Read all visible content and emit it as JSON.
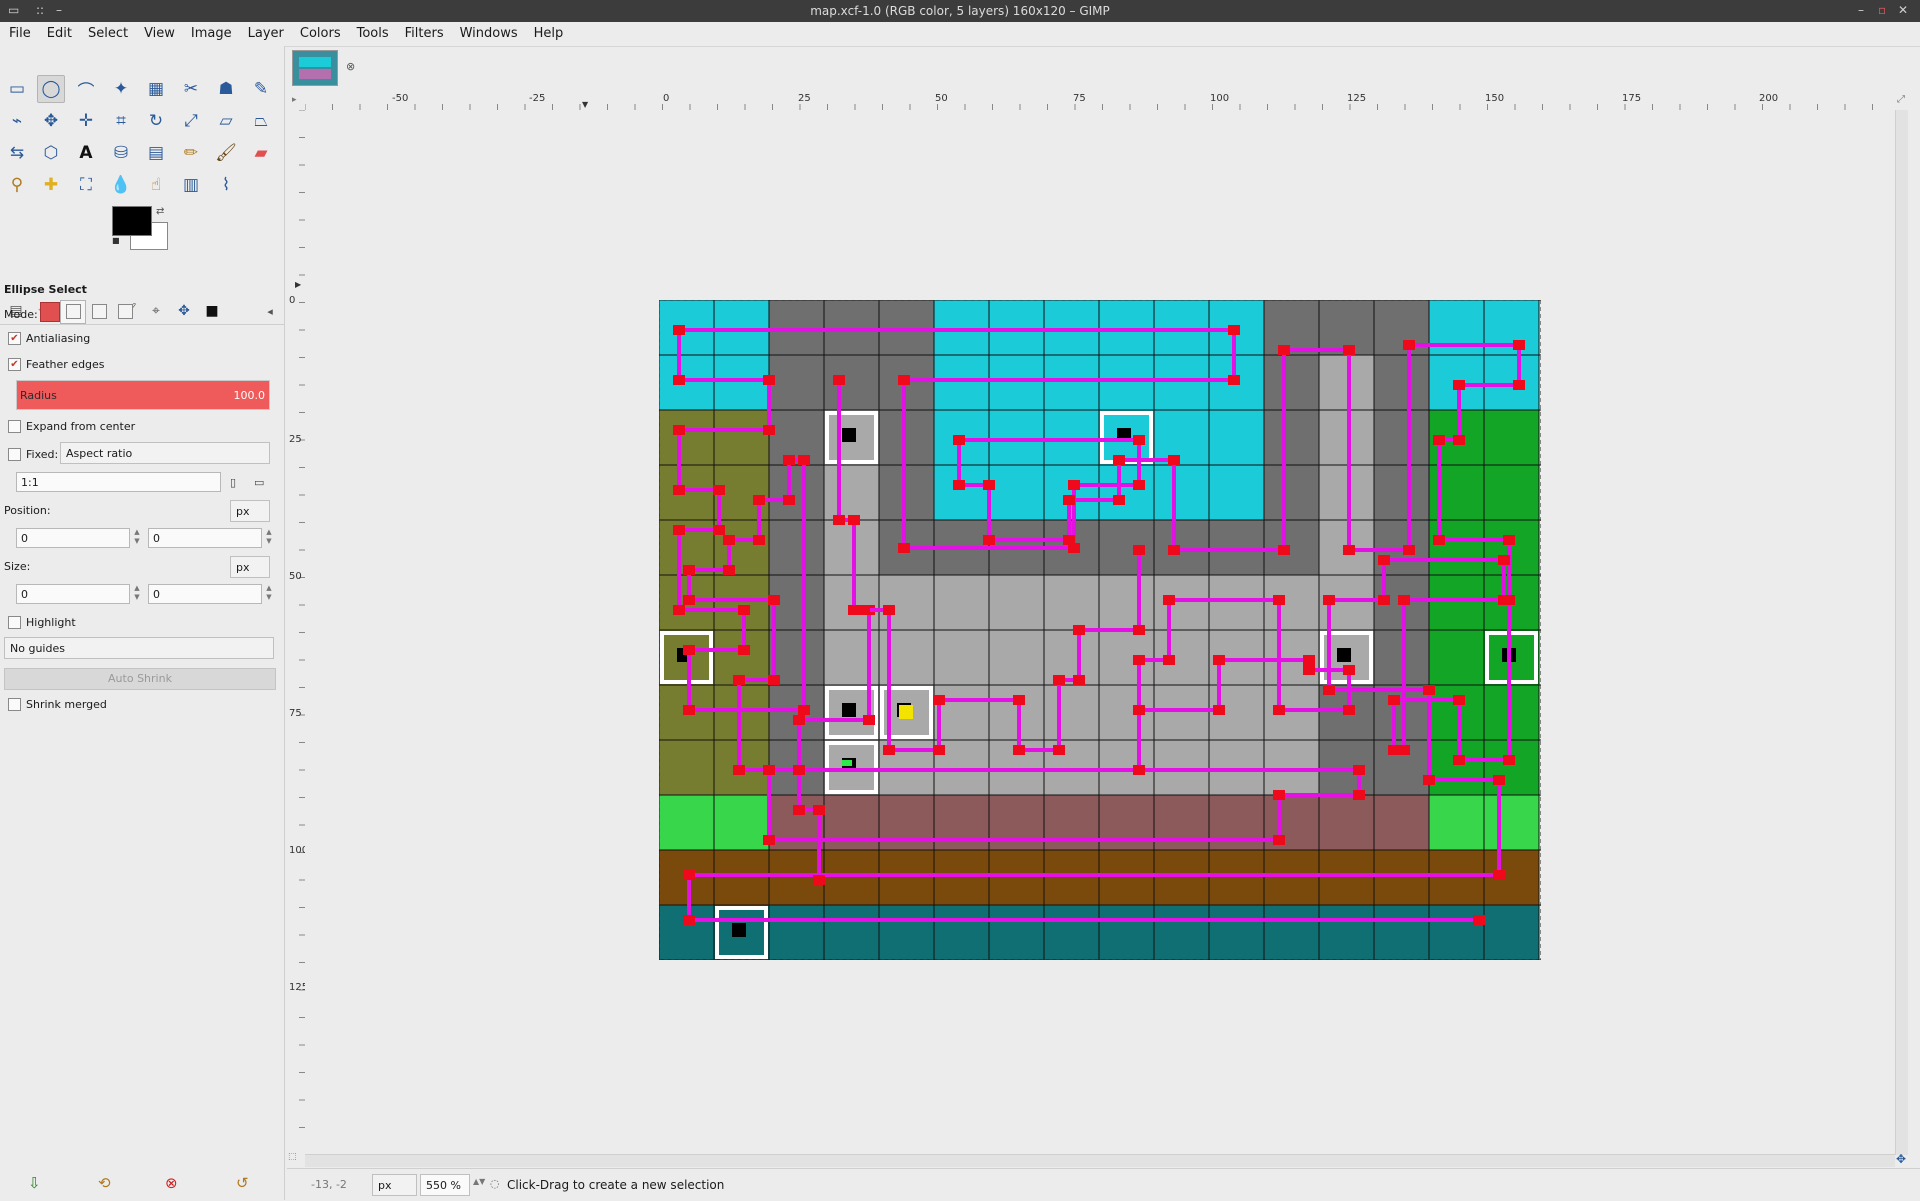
{
  "window": {
    "title": "map.xcf-1.0 (RGB color, 5 layers) 160x120 – GIMP"
  },
  "menu": [
    "File",
    "Edit",
    "Select",
    "View",
    "Image",
    "Layer",
    "Colors",
    "Tools",
    "Filters",
    "Windows",
    "Help"
  ],
  "tool_options": {
    "title": "Ellipse Select",
    "mode_label": "Mode:",
    "antialiasing": "Antialiasing",
    "feather": "Feather edges",
    "radius_label": "Radius",
    "radius_value": "100.0",
    "expand": "Expand from center",
    "fixed": "Fixed:",
    "fixed_mode": "Aspect ratio",
    "ratio": "1:1",
    "position_label": "Position:",
    "position_unit": "px",
    "position_x": "0",
    "position_y": "0",
    "size_label": "Size:",
    "size_unit": "px",
    "size_w": "0",
    "size_h": "0",
    "highlight": "Highlight",
    "guides": "No guides",
    "auto_shrink": "Auto Shrink",
    "shrink_merged": "Shrink merged"
  },
  "hruler_labels": [
    "-50",
    "-25",
    "0",
    "25",
    "50",
    "75",
    "100",
    "125",
    "150",
    "175",
    "200"
  ],
  "vruler_labels": [
    "0",
    "25",
    "50",
    "75",
    "100",
    "125"
  ],
  "status": {
    "coords": "-13, -2",
    "unit": "px",
    "zoom": "550 %",
    "message": "Click-Drag to create a new selection"
  },
  "map": {
    "cols": 16,
    "rows": 12,
    "colors": {
      "cyan": "#1ccbd8",
      "dark_gray": "#6f6f6f",
      "light_gray": "#a9a9a9",
      "olive": "#777d30",
      "green": "#12a526",
      "light_green": "#38d64a",
      "brown_red": "#8c5a5a",
      "brown": "#7a4a0c",
      "teal": "#0f6f73",
      "path": "#e410e4",
      "node": "#ee0a1a"
    }
  }
}
